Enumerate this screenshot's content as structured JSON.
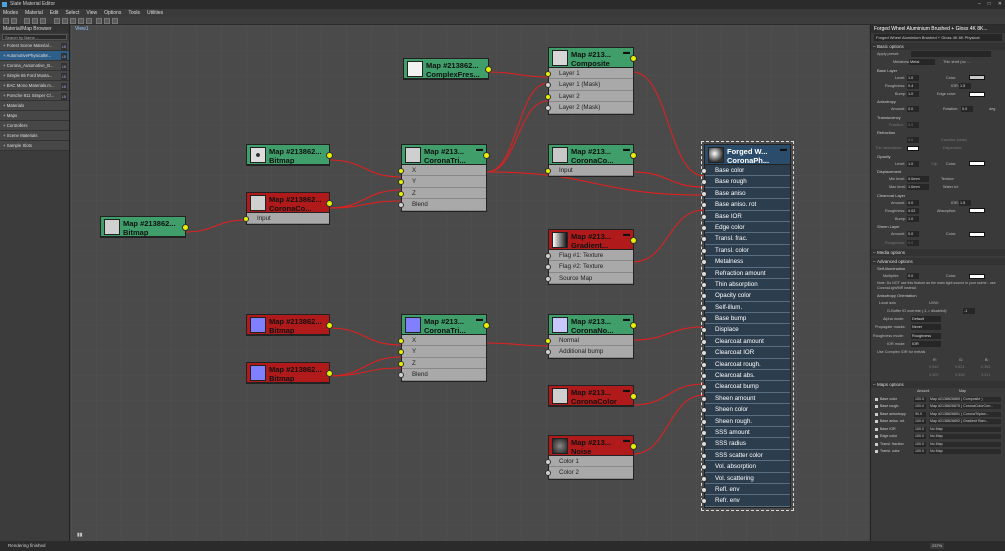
{
  "window": {
    "title": "Slate Material Editor",
    "controls": [
      "–",
      "□",
      "✕"
    ]
  },
  "menu": [
    "Modes",
    "Material",
    "Edit",
    "Select",
    "View",
    "Options",
    "Tools",
    "Utilities"
  ],
  "view_tab_right": "View1",
  "left_panel": {
    "title": "Material/Map Browser",
    "search_placeholder": "Search by Name ...",
    "items": [
      {
        "label": "+ Forest Scene Material...",
        "badge": "LB",
        "selected": false
      },
      {
        "label": "+ AutomotivePhysicalM...",
        "badge": "LB",
        "selected": true
      },
      {
        "label": "+ Corona_Automotive_B...",
        "badge": "LB",
        "selected": false
      },
      {
        "label": "+ Simple 65 Ford Musta...",
        "badge": "LB",
        "selected": false
      },
      {
        "label": "+ BAC Mono Materials.m...",
        "badge": "LB",
        "selected": false
      },
      {
        "label": "+ Porsche 911 Simper Cl...",
        "badge": "LB",
        "selected": false
      },
      {
        "label": "+ Materials",
        "badge": "",
        "selected": false
      },
      {
        "label": "+ Maps",
        "badge": "",
        "selected": false
      },
      {
        "label": "+ Controllers",
        "badge": "",
        "selected": false
      },
      {
        "label": "+ Scene Materials",
        "badge": "",
        "selected": false
      },
      {
        "label": "+ Sample Slots",
        "badge": "",
        "selected": false
      }
    ]
  },
  "viewport": {
    "tab": "View1"
  },
  "nodes": {
    "complexfresnel": {
      "t1": "Map #213862...",
      "t2": "ComplexFres..."
    },
    "composite": {
      "t1": "Map #213...",
      "t2": "Composite",
      "slots": [
        "Layer 1",
        "Layer 1 (Mask)",
        "Layer 2",
        "Layer 2 (Mask)"
      ]
    },
    "bitmap_top": {
      "t1": "Map #213862...",
      "t2": "Bitmap"
    },
    "coronaco_top": {
      "t1": "Map #213862...",
      "t2": "CoronaCo...",
      "slots": [
        "Input"
      ]
    },
    "bitmap_left": {
      "t1": "Map #213862...",
      "t2": "Bitmap"
    },
    "triplanar_top": {
      "t1": "Map #213...",
      "t2": "CoronaTri...",
      "slots": [
        "X",
        "Y",
        "Z",
        "Blend"
      ]
    },
    "coronaco_mid": {
      "t1": "Map #213...",
      "t2": "CoronaCo...",
      "slots": [
        "Input"
      ]
    },
    "gradient": {
      "t1": "Map #213...",
      "t2": "Gradient...",
      "slots": [
        "Flag #1: Texture",
        "Flag #2: Texture",
        "Source Map"
      ]
    },
    "bitmap_b1": {
      "t1": "Map #213862...",
      "t2": "Bitmap"
    },
    "bitmap_b2": {
      "t1": "Map #213862...",
      "t2": "Bitmap"
    },
    "triplanar_bot": {
      "t1": "Map #213...",
      "t2": "CoronaTri...",
      "slots": [
        "X",
        "Y",
        "Z",
        "Blend"
      ]
    },
    "coronanormal": {
      "t1": "Map #213...",
      "t2": "CoronaNo...",
      "slots": [
        "Normal",
        "Additional bump"
      ]
    },
    "coronacolor": {
      "t1": "Map #213...",
      "t2": "CoronaColor"
    },
    "noise": {
      "t1": "Map #213...",
      "t2": "Noise",
      "slots": [
        "Color 1",
        "Color 2"
      ]
    },
    "material": {
      "t1": "Forged W...",
      "t2": "CoronaPh...",
      "slots": [
        "Base color",
        "Base rough",
        "Base aniso",
        "Base aniso. rot",
        "Base IOR",
        "Edge color",
        "Transl. frac.",
        "Transl. color",
        "Metalness",
        "Refraction amount",
        "Thin absorption",
        "Opacity color",
        "Self-illum.",
        "Base bump",
        "Displace",
        "Clearcoat amount",
        "Clearcoat IOR",
        "Clearcoat rough.",
        "Clearcoat abs.",
        "Clearcoat bump",
        "Sheen amount",
        "Sheen color",
        "Sheen rough.",
        "SSS amount",
        "SSS radius",
        "SSS scatter color",
        "Vol. absorption",
        "Vol. scattering",
        "Refl. env",
        "Refr. env"
      ]
    }
  },
  "right_panel": {
    "title": "Forged Wheel Aluminium Brushed + Gloss 4K 8K...",
    "name_field": "Forged Wheel Aluminium Brushed + Gloss 4K 8K Physical",
    "basic_options": "Basic options",
    "apply_preset": "Apply preset:",
    "metalness_label": "Metalness:",
    "metalness_value": "Metal",
    "thin_shell": "Thin shell (no ...",
    "base_layer": "Base Layer",
    "level_lbl": "Level:",
    "level_val": "1.0",
    "color_lbl": "Color:",
    "roughness_lbl": "Roughness:",
    "roughness_val": "0.4",
    "ior_lbl": "IOR:",
    "ior_val": "1.5",
    "bump_lbl": "Bump:",
    "bump_val": "1.0",
    "edge_color_lbl": "Edge color:",
    "anisotropy": "Anisotropy",
    "amount_lbl": "Amount:",
    "amount_val": "0.0",
    "rotation_lbl": "Rotation:",
    "rotation_val": "0.0",
    "deg": "deg",
    "translucency": "Translucency",
    "fraction_lbl": "Fraction:",
    "fraction_val": "0.0",
    "refraction": "Refraction",
    "ref_amount_val": "0.0",
    "caustics": "Caustics (slow)",
    "thin_absorption": "Thin absorption:",
    "dispersion": "Dispersion:",
    "opacity": "Opacity",
    "opacity_level_val": "1.0",
    "clip": "Clip",
    "displacement": "Displacement",
    "min_level_lbl": "Min level:",
    "min_level_val": "0.0mm",
    "texture_lbl": "Texture:",
    "max_level_lbl": "Max level:",
    "max_level_val": "1.0mm",
    "water_lvl": "Water lvl:",
    "clearcoat": "Clearcoat Layer",
    "cc_amount_val": "0.0",
    "cc_ior_val": "1.5",
    "cc_rough_val": "0.02",
    "absorption_lbl": "Absorption:",
    "cc_bump_val": "1.0",
    "sheen": "Sheen Layer",
    "sheen_amount_val": "0.0",
    "sheen_rough_lbl": "Roughness:",
    "sheen_rough_val": "0.0",
    "media_options": "Media options",
    "advanced_options": "Advanced options",
    "self_illum": "Self-illumination",
    "multiplier_lbl": "Multiplier:",
    "multiplier_val": "0.0",
    "note": "Note: Do NOT use this feature as the main light source in your scene - use CoronaLight/MR instead.",
    "aniso_orient": "Anisotropy Orientation",
    "local_axis": "Local axis",
    "uvw": "UVW:",
    "gbuffer": "G-Buffer ID override (-1 = disabled):",
    "gbuffer_val": "-1",
    "alpha_mode_lbl": "Alpha mode:",
    "alpha_mode_val": "Default",
    "propagate_lbl": "Propagate masks:",
    "propagate_val": "Never",
    "rough_mode_lbl": "Roughness mode:",
    "rough_mode_val": "Roughness",
    "ior_mode_lbl": "IOR mode:",
    "ior_mode_val": "IOR",
    "complex_ior": "Use Complex IOR for metals",
    "rgb_head": [
      "R:",
      "G:",
      "B:"
    ],
    "n_row": [
      "0.542",
      "0.824",
      "0.352"
    ],
    "k_row": [
      "3.500",
      "0.508",
      "3.311"
    ],
    "maps_options": "Maps options",
    "maps_headers": [
      "Amount",
      "Map"
    ],
    "maps": [
      {
        "label": "Base color",
        "amount": "100.0",
        "map": "Map #2138626889 ( Composite )"
      },
      {
        "label": "Base rough.",
        "amount": "100.0",
        "map": "Map #2138626875 ( CoronaColorCorr..."
      },
      {
        "label": "Base anisotropy",
        "amount": "90.0",
        "map": "Map #2138626891 ( CoronaTriplan..."
      },
      {
        "label": "Base aniso. rot.",
        "amount": "100.0",
        "map": "Map #2138626892 ( Gradient Ram..."
      },
      {
        "label": "Base IOR",
        "amount": "100.0",
        "map": "No Map"
      },
      {
        "label": "Edge color",
        "amount": "100.0",
        "map": "No Map"
      },
      {
        "label": "Transl. fraction",
        "amount": "100.0",
        "map": "No Map"
      },
      {
        "label": "Transl. color",
        "amount": "100.0",
        "map": "No Map"
      }
    ]
  },
  "status": {
    "text": "Rendering finished",
    "zoom": "237%"
  }
}
